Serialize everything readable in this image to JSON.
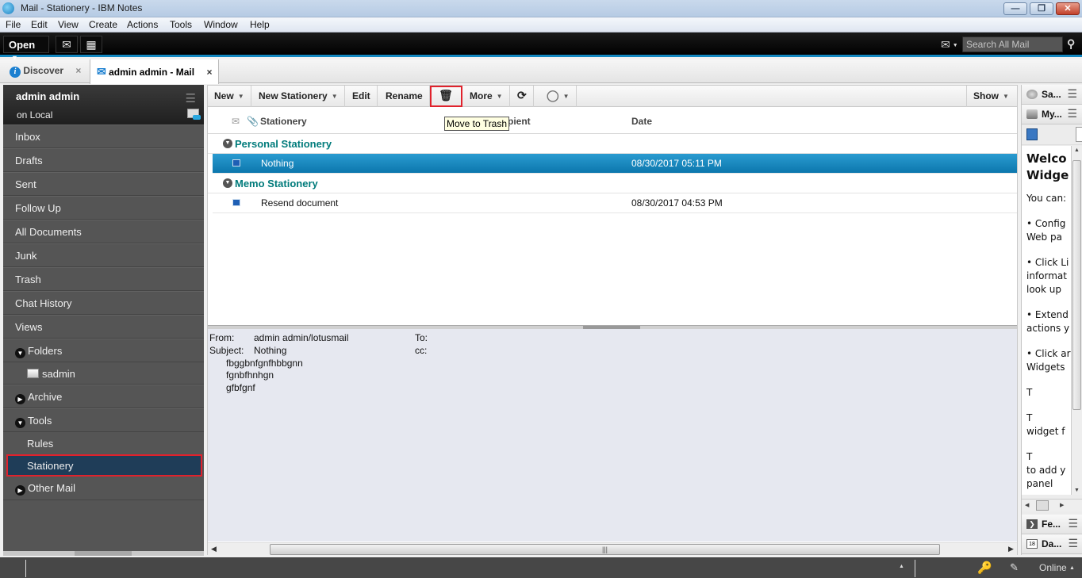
{
  "window": {
    "title": "Mail - Stationery - IBM Notes",
    "controls": {
      "minimize": "—",
      "restore": "❐",
      "close": "✕"
    }
  },
  "menubar": [
    "File",
    "Edit",
    "View",
    "Create",
    "Actions",
    "Tools",
    "Window",
    "Help"
  ],
  "blackbar": {
    "open_label": "Open",
    "mail_icon": "envelope-icon",
    "calendar_icon": "calendar-icon",
    "search_placeholder": "Search All Mail"
  },
  "tabs": [
    {
      "label": "Discover",
      "icon": "info-icon",
      "active": false,
      "close": "×"
    },
    {
      "label": "admin admin - Mail",
      "icon": "envelope-icon",
      "active": true,
      "close": "×"
    }
  ],
  "sidebar": {
    "user": "admin admin",
    "location": "on Local",
    "items": [
      {
        "label": "Inbox"
      },
      {
        "label": "Drafts"
      },
      {
        "label": "Sent"
      },
      {
        "label": "Follow Up"
      },
      {
        "label": "All Documents"
      },
      {
        "label": "Junk"
      },
      {
        "label": "Trash"
      },
      {
        "label": "Chat History"
      },
      {
        "label": "Views"
      }
    ],
    "folders": {
      "label": "Folders",
      "expanded": true,
      "children": [
        "sadmin"
      ]
    },
    "archive": {
      "label": "Archive",
      "expanded": false
    },
    "tools": {
      "label": "Tools",
      "expanded": true,
      "children": [
        "Rules",
        "Stationery"
      ],
      "selected": "Stationery"
    },
    "other_mail": {
      "label": "Other Mail",
      "expanded": false
    }
  },
  "toolbar": {
    "new": "New",
    "new_stationery": "New Stationery",
    "edit": "Edit",
    "rename": "Rename",
    "trash_tooltip": "Move to Trash",
    "more": "More",
    "show": "Show"
  },
  "columns": {
    "stationery": "Stationery",
    "recipient": "Recipient",
    "date": "Date",
    "recipient_visible": "pient"
  },
  "groups": [
    {
      "label": "Personal Stationery",
      "rows": [
        {
          "subject": "Nothing",
          "date": "08/30/2017 05:11 PM",
          "selected": true
        }
      ]
    },
    {
      "label": "Memo Stationery",
      "rows": [
        {
          "subject": "Resend document",
          "date": "08/30/2017 04:53 PM",
          "selected": false
        }
      ]
    }
  ],
  "preview": {
    "from_label": "From:",
    "from_value": "admin admin/lotusmail",
    "subject_label": "Subject:",
    "subject_value": "Nothing",
    "to_label": "To:",
    "cc_label": "cc:",
    "body": [
      "fbggbnfgnfhbbgnn",
      "fgnbfhnhgn",
      "gfbfgnf"
    ]
  },
  "right_panel": {
    "headers_top": [
      {
        "label": "Sa...",
        "icon": "sametime-icon"
      },
      {
        "label": "My...",
        "icon": "toolbox-icon"
      }
    ],
    "headers_bottom": [
      {
        "label": "Fe...",
        "icon": "feed-icon"
      },
      {
        "label": "Da...",
        "icon": "calendar-day-icon"
      }
    ],
    "content_lines": [
      "Welco",
      "Widge",
      "",
      "You can:",
      "",
      "• Config",
      "Web pa",
      "",
      "• Click Li",
      "informat",
      "look up",
      "",
      "• Extend",
      "actions y",
      "",
      "• Click ar",
      "Widgets",
      "",
      "      T",
      "",
      "      T",
      "widget f",
      "",
      "      T",
      "to add y",
      "panel"
    ]
  },
  "statusbar": {
    "status": "Online"
  }
}
